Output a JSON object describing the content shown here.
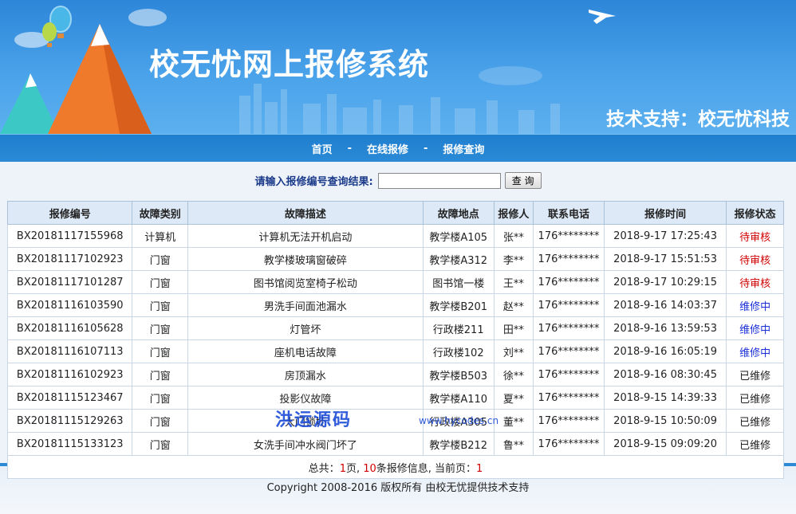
{
  "header": {
    "title": "校无忧网上报修系统",
    "support": "技术支持：校无忧科技"
  },
  "nav": [
    {
      "label": "首页"
    },
    {
      "label": "在线报修"
    },
    {
      "label": "报修查询"
    }
  ],
  "nav_separator": "-",
  "search": {
    "label": "请输入报修编号查询结果:",
    "input_value": "",
    "button_label": "查 询"
  },
  "table": {
    "headers": [
      "报修编号",
      "故障类别",
      "故障描述",
      "故障地点",
      "报修人",
      "联系电话",
      "报修时间",
      "报修状态"
    ],
    "rows": [
      [
        "BX20181117155968",
        "计算机",
        "计算机无法开机启动",
        "教学楼A105",
        "张**",
        "176********",
        "2018-9-17 17:25:43",
        "待审核"
      ],
      [
        "BX20181117102923",
        "门窗",
        "教学楼玻璃窗破碎",
        "教学楼A312",
        "李**",
        "176********",
        "2018-9-17 15:51:53",
        "待审核"
      ],
      [
        "BX20181117101287",
        "门窗",
        "图书馆阅览室椅子松动",
        "图书馆一楼",
        "王**",
        "176********",
        "2018-9-17 10:29:15",
        "待审核"
      ],
      [
        "BX20181116103590",
        "门窗",
        "男洗手间面池漏水",
        "教学楼B201",
        "赵**",
        "176********",
        "2018-9-16 14:03:37",
        "维修中"
      ],
      [
        "BX20181116105628",
        "门窗",
        "灯管坏",
        "行政楼211",
        "田**",
        "176********",
        "2018-9-16 13:59:53",
        "维修中"
      ],
      [
        "BX20181116107113",
        "门窗",
        "座机电话故障",
        "行政楼102",
        "刘**",
        "176********",
        "2018-9-16 16:05:19",
        "维修中"
      ],
      [
        "BX20181116102923",
        "门窗",
        "房顶漏水",
        "教学楼B503",
        "徐**",
        "176********",
        "2018-9-16 08:30:45",
        "已维修"
      ],
      [
        "BX20181115123467",
        "门窗",
        "投影仪故障",
        "教学楼A110",
        "夏**",
        "176********",
        "2018-9-15 14:39:33",
        "已维修"
      ],
      [
        "BX20181115129263",
        "门窗",
        "大门锁坏",
        "行政楼A305",
        "董**",
        "176********",
        "2018-9-15 10:50:09",
        "已维修"
      ],
      [
        "BX20181115133123",
        "门窗",
        "女洗手间冲水阀门坏了",
        "教学楼B212",
        "鲁**",
        "176********",
        "2018-9-15 09:09:20",
        "已维修"
      ]
    ],
    "status_colors": {
      "待审核": "#d00000",
      "维修中": "#1a2fd6",
      "已维修": "#222222"
    },
    "footer": {
      "total_prefix": "总共：",
      "pages": "1",
      "pages_suffix": "页, ",
      "records": "10",
      "records_suffix": "条报修信息, 当前页：",
      "current_page": "1"
    }
  },
  "watermark": {
    "text": "洪运源码",
    "url": "www.hycodes.cn"
  },
  "copyright": "Copyright 2008-2016 版权所有 由校无忧提供技术支持"
}
